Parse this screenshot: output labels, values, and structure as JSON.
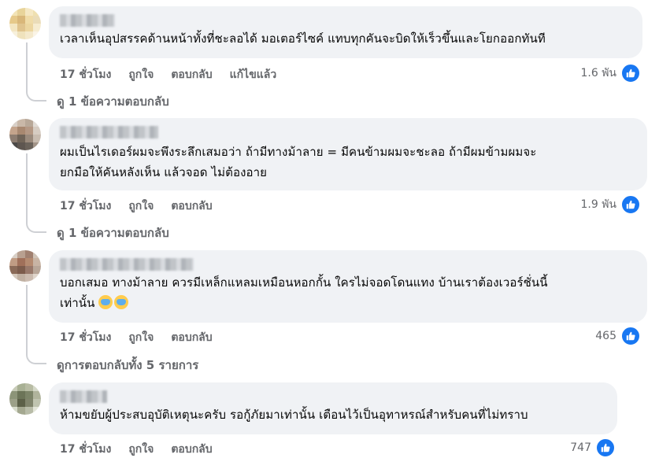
{
  "comments": [
    {
      "text": "เวลาเห็นอุปสรรคด้านหน้าทั้งที่ชะลอได้ มอเตอร์ไซค์ แทบทุกคันจะบิดให้เร็วขึ้นและโยกออกทันที",
      "time": "17 ชั่วโมง",
      "like_label": "ถูกใจ",
      "reply_label": "ตอบกลับ",
      "edited_label": "แก้ไขแล้ว",
      "reactions": "1.6 พัน",
      "replies_link": "ดู 1 ข้อความตอบกลับ"
    },
    {
      "text": "ผมเป็นไรเดอร์ผมจะพึงระลึกเสมอว่า ถ้ามีทางม้าลาย = มีคนข้ามผมจะชะลอ ถ้ามีผมข้ามผมจะ\nยกมือให้คันหลังเห็น แล้วจอด ไม่ต้องอาย",
      "time": "17 ชั่วโมง",
      "like_label": "ถูกใจ",
      "reply_label": "ตอบกลับ",
      "reactions": "1.9 พัน",
      "replies_link": "ดู 1 ข้อความตอบกลับ"
    },
    {
      "text": "บอกเสมอ ทางม้าลาย ควรมีเหล็กแหลมเหมือนหอกกั้น ใครไม่จอดโดนแทง บ้านเราต้องเวอร์ชั่นนี้\nเท่านั้น",
      "time": "17 ชั่วโมง",
      "like_label": "ถูกใจ",
      "reply_label": "ตอบกลับ",
      "reactions": "465",
      "replies_link": "ดูการตอบกลับทั้ง 5 รายการ"
    },
    {
      "text": "ห้ามขยับผู้ประสบอุบัติเหตุนะครับ รอกู้ภัยมาเท่านั้น เตือนไว้เป็นอุทาหรณ์สำหรับคนที่ไม่ทราบ",
      "time": "17 ชั่วโมง",
      "like_label": "ถูกใจ",
      "reply_label": "ตอบกลับ",
      "reactions": "747"
    }
  ],
  "colors": {
    "bubble": "#f0f2f5",
    "meta_text": "#65676b",
    "like_blue": "#1877f2"
  },
  "icons": [
    "like-icon",
    "cold-sweat-emoji"
  ]
}
